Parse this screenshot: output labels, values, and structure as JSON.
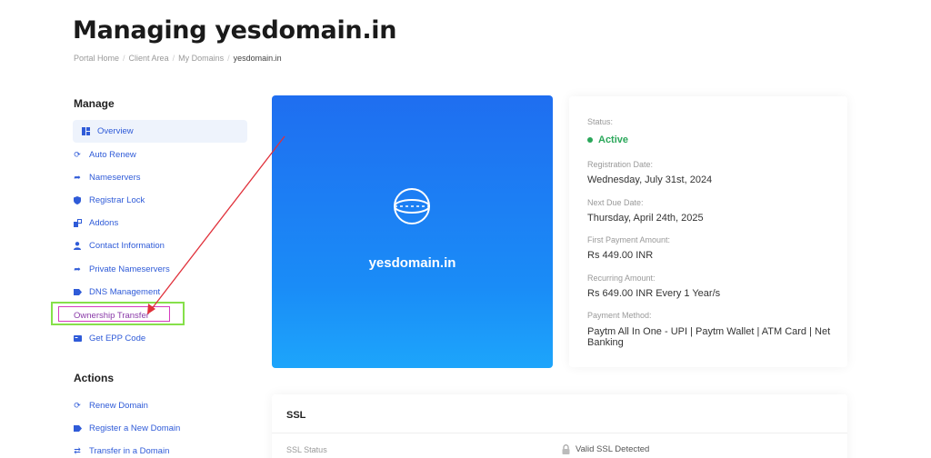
{
  "page": {
    "title": "Managing yesdomain.in",
    "breadcrumb": [
      "Portal Home",
      "Client Area",
      "My Domains",
      "yesdomain.in"
    ]
  },
  "manage": {
    "heading": "Manage",
    "items": [
      {
        "label": "Overview",
        "icon": "dashboard-icon"
      },
      {
        "label": "Auto Renew",
        "icon": "refresh-icon"
      },
      {
        "label": "Nameservers",
        "icon": "arrow-right-icon"
      },
      {
        "label": "Registrar Lock",
        "icon": "shield-icon"
      },
      {
        "label": "Addons",
        "icon": "cubes-icon"
      },
      {
        "label": "Contact Information",
        "icon": "user-icon"
      },
      {
        "label": "Private Nameservers",
        "icon": "arrow-right-icon"
      },
      {
        "label": "DNS Management",
        "icon": "tag-icon"
      },
      {
        "label": "Ownership Transfer",
        "icon": ""
      },
      {
        "label": "Get EPP Code",
        "icon": "card-icon"
      }
    ]
  },
  "actions": {
    "heading": "Actions",
    "items": [
      {
        "label": "Renew Domain",
        "icon": "refresh-icon"
      },
      {
        "label": "Register a New Domain",
        "icon": "tag-icon"
      },
      {
        "label": "Transfer in a Domain",
        "icon": "exchange-icon"
      }
    ]
  },
  "hero": {
    "domain": "yesdomain.in",
    "icon": "globe-icon"
  },
  "info": {
    "status_label": "Status:",
    "status_value": "Active",
    "registration_label": "Registration Date:",
    "registration_value": "Wednesday, July 31st, 2024",
    "next_due_label": "Next Due Date:",
    "next_due_value": "Thursday, April 24th, 2025",
    "first_payment_label": "First Payment Amount:",
    "first_payment_value": "Rs 449.00 INR",
    "recurring_label": "Recurring Amount:",
    "recurring_value": "Rs 649.00 INR Every 1 Year/s",
    "payment_method_label": "Payment Method:",
    "payment_method_value": "Paytm All In One - UPI | Paytm Wallet | ATM Card | Net Banking"
  },
  "ssl": {
    "title": "SSL",
    "status_label": "SSL Status",
    "status_value": "Valid SSL Detected"
  },
  "colors": {
    "link": "#2f5bd8",
    "active_status": "#2aa75a",
    "highlight_green": "#86e04a",
    "highlight_pink": "#d63bbf",
    "annotation_arrow": "#e0303a"
  }
}
